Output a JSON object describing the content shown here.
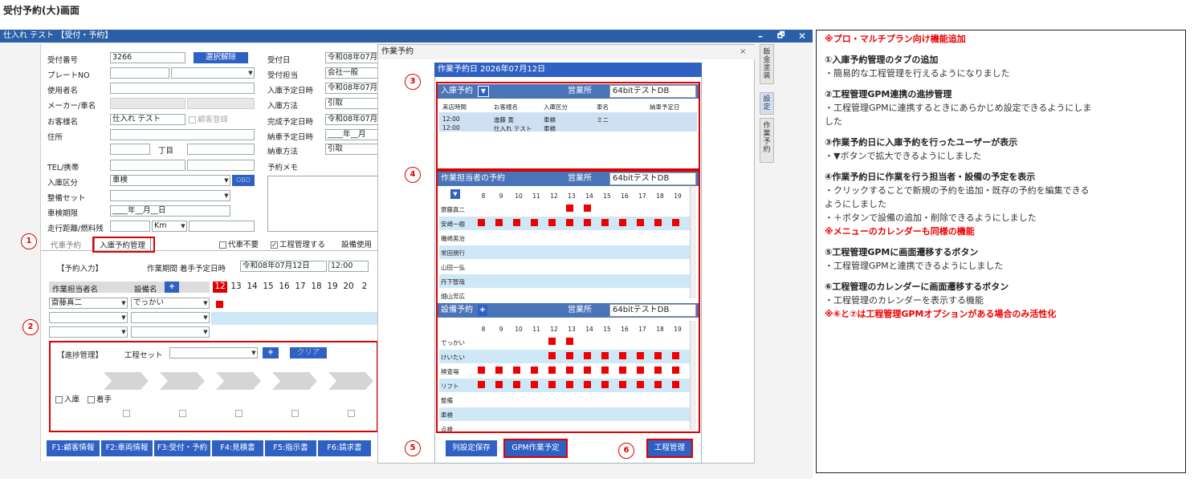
{
  "page_title": "受付予約(大)画面",
  "window": {
    "title": "仕入れ テスト 【受付・予約】",
    "controls": {
      "minimize": "–",
      "restore": "🗗",
      "close": "✕"
    }
  },
  "form": {
    "left_labels": [
      "受付番号",
      "プレートNO",
      "使用者名",
      "メーカー/車名",
      "お客様名",
      "住所",
      "",
      "TEL/携帯",
      "入庫区分",
      "整備セット",
      "車検期限",
      "走行距離/燃料残"
    ],
    "receipt_no": "3266",
    "clear_button": "選択解除",
    "customer_name": "仕入れ テスト",
    "register_customer": "顧客登録",
    "chome": "丁目",
    "entry_type": "車検",
    "obd": "OBD",
    "inspection_date": "____年__月__日",
    "km": "Km",
    "right_labels": [
      "受付日",
      "受付担当",
      "入庫予定日時",
      "入庫方法",
      "完成予定日時",
      "納車予定日時",
      "納車方法",
      "予約メモ"
    ],
    "right_values": [
      "令和08年07月",
      "会社一般",
      "令和08年07月",
      "引取",
      "令和08年07月",
      "____年__月",
      "引取",
      ""
    ],
    "tabs": [
      "代車予約",
      "入庫予約管理"
    ],
    "options": [
      "代車不要",
      "工程管理する",
      "設備使用"
    ],
    "reservation_input": "【予約入力】",
    "work_period": "作業期間 着手予定日時",
    "work_date": "令和08年07月12日",
    "work_time": "12:00",
    "grid_headers": [
      "作業担当者名",
      "設備名"
    ],
    "grid_days": [
      "12",
      "13",
      "14",
      "15",
      "16",
      "17",
      "18",
      "19",
      "20",
      "2"
    ],
    "staff_value": "齋藤真二",
    "equipment_value": "でっかい",
    "progress_title": "【進捗管理】",
    "process_set": "工程セット",
    "clear2": "クリア",
    "checks": [
      "入庫",
      "着手"
    ]
  },
  "fkeys": [
    "F1:顧客情報",
    "F2:車両情報",
    "F3:受付・予約",
    "F4:見積書",
    "F5:指示書",
    "F6:請求書"
  ],
  "subwin": {
    "title": "作業予約",
    "close": "×",
    "header": "作業予約日 2026年07月12日",
    "office_label": "営業所",
    "office_value": "64bitテストDB",
    "sec1": {
      "title": "入庫予約",
      "cols": [
        "来店時間",
        "お客様名",
        "入庫区分",
        "車名",
        "納車予定日"
      ],
      "rows": [
        [
          "12:00",
          "進藤 寛",
          "車検",
          "ミニ",
          ""
        ],
        [
          "12:00",
          "仕入れ テスト",
          "車検",
          "",
          ""
        ]
      ]
    },
    "sec2": {
      "title": "作業担当者の予約",
      "hours": [
        "8",
        "9",
        "10",
        "11",
        "12",
        "13",
        "14",
        "15",
        "16",
        "17",
        "18",
        "19"
      ],
      "rows": [
        "齋藤真二",
        "安崎一樹",
        "磯崎英治",
        "常田朋行",
        "山田一弘",
        "丹下智哉",
        "畑山芳広"
      ]
    },
    "sec3": {
      "title": "設備予約",
      "hours": [
        "8",
        "9",
        "10",
        "11",
        "12",
        "13",
        "14",
        "15",
        "16",
        "17",
        "18",
        "19"
      ],
      "rows": [
        "でっかい",
        "けいたい",
        "検査場",
        "リフト",
        "整備",
        "車検",
        "点検"
      ]
    },
    "buttons": [
      "列設定保存",
      "GPM作業予定",
      "工程管理"
    ],
    "side_tabs": [
      "鈑金塗装",
      "設定",
      "作業予約"
    ]
  },
  "markers": [
    "1",
    "2",
    "3",
    "4",
    "5",
    "6"
  ],
  "notes": {
    "title": "※プロ・マルチプラン向け機能追加",
    "items": [
      {
        "h": "①入庫予約管理のタブの追加",
        "b": [
          "・簡易的な工程管理を行えるようになりました"
        ]
      },
      {
        "h": "②工程管理GPM連携の進捗管理",
        "b": [
          "・工程管理GPMに連携するときにあらかじめ設定できるようにしま",
          "した"
        ]
      },
      {
        "h": "③作業予約日に入庫予約を行ったユーザーが表示",
        "b": [
          "・▼ボタンで拡大できるようにしました"
        ]
      },
      {
        "h": "④作業予約日に作業を行う担当者・設備の予定を表示",
        "b": [
          "・クリックすることで新規の予約を追加・既存の予約を編集できる",
          "ようにしました",
          "・＋ボタンで設備の追加・削除できるようにしました"
        ],
        "red": "※メニューのカレンダーも同様の機能"
      },
      {
        "h": "⑤工程管理GPMに画面遷移するボタン",
        "b": [
          "・工程管理GPMと連携できるようにしました"
        ]
      },
      {
        "h": "⑥工程管理のカレンダーに画面遷移するボタン",
        "b": [
          "・工程管理のカレンダーを表示する機能"
        ],
        "red": "※⑥と⑦は工程管理GPMオプションがある場合のみ活性化"
      }
    ]
  }
}
